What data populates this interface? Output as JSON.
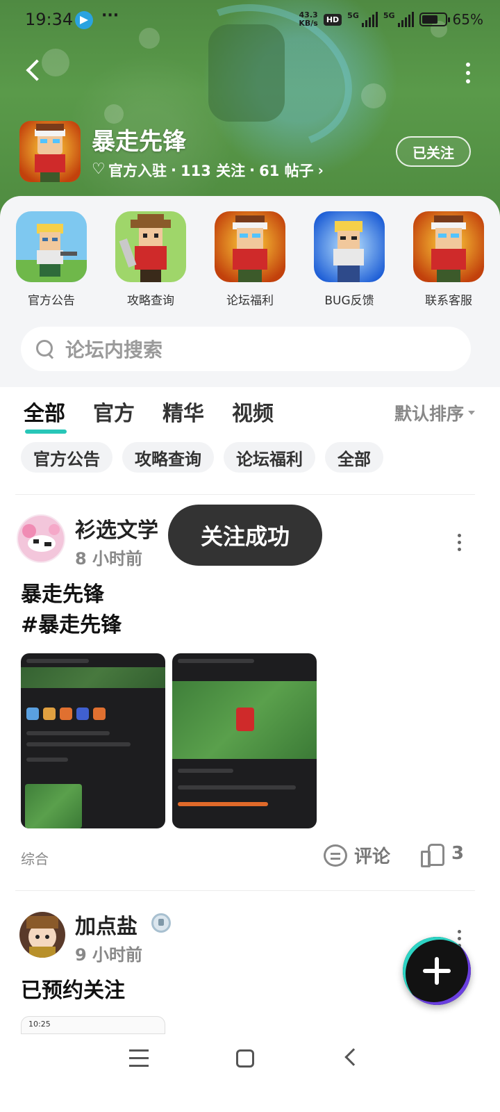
{
  "status_bar": {
    "time": "19:34",
    "more": "···",
    "net_speed_top": "43.3",
    "net_speed_bottom": "KB/s",
    "hd": "HD",
    "sig1": "5G",
    "sig2": "5G",
    "battery": "65%"
  },
  "header": {
    "title": "暴走先锋",
    "meta_official": "官方入驻",
    "meta_sep1": "·",
    "meta_follow": "113 关注",
    "meta_sep2": "·",
    "meta_posts": "61 帖子",
    "meta_chevron": "›",
    "follow_label": "已关注"
  },
  "shortcuts": [
    {
      "label": "官方公告"
    },
    {
      "label": "攻略查询"
    },
    {
      "label": "论坛福利"
    },
    {
      "label": "BUG反馈"
    },
    {
      "label": "联系客服"
    }
  ],
  "search": {
    "placeholder": "论坛内搜索"
  },
  "tabs": [
    {
      "label": "全部"
    },
    {
      "label": "官方"
    },
    {
      "label": "精华"
    },
    {
      "label": "视频"
    }
  ],
  "sort_label": "默认排序",
  "chips": [
    {
      "label": "官方公告"
    },
    {
      "label": "攻略查询"
    },
    {
      "label": "论坛福利"
    },
    {
      "label": "全部"
    }
  ],
  "posts": [
    {
      "author": "衫选文学",
      "time": "8 小时前",
      "line1": "暴走先锋",
      "line2": "#暴走先锋",
      "category": "综合",
      "comment_label": "评论",
      "likes": "3"
    },
    {
      "author": "加点盐",
      "time": "9 小时前",
      "line1": "已预约关注",
      "snippet": "10:25"
    }
  ],
  "toast": "关注成功",
  "icons": {
    "back": "back-arrow-icon",
    "more": "more-vertical-icon",
    "search": "search-icon",
    "comment": "comment-icon",
    "like": "thumbs-up-icon",
    "fab": "plus-icon"
  },
  "colors": {
    "accent": "#28c6b8",
    "toast_bg": "#333333",
    "header_green": "#4f8a42"
  }
}
